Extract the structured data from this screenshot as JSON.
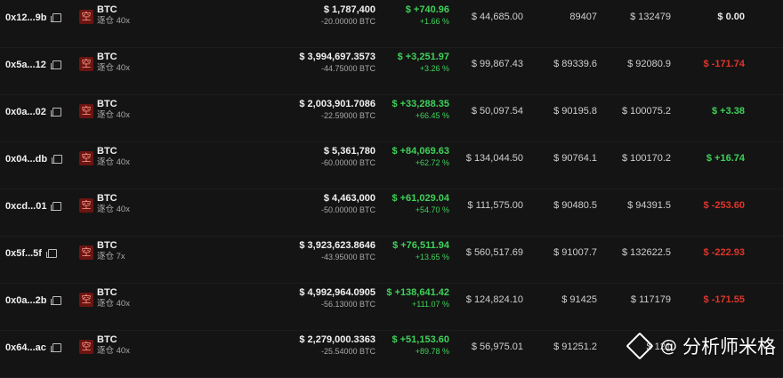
{
  "colors": {
    "positive": "#3fd15a",
    "negative": "#e0352b",
    "neutral": "#eaeaea",
    "badge_bg": "#6b1512"
  },
  "rows": [
    {
      "address": "0x12...9b",
      "badge": "空",
      "coin": "BTC",
      "leverage": "逐仓 40x",
      "size_usd": "$ 1,787,400",
      "size_qty": "-20.00000 BTC",
      "pnl_usd": "$ +740.96",
      "pnl_pct": "+1.66 %",
      "entry": "$ 44,685.00",
      "mark": "89407",
      "liq": "$ 132479",
      "funding": "$ 0.00",
      "funding_color": "#eaeaea"
    },
    {
      "address": "0x5a...12",
      "badge": "空",
      "coin": "BTC",
      "leverage": "逐仓 40x",
      "size_usd": "$ 3,994,697.3573",
      "size_qty": "-44.75000 BTC",
      "pnl_usd": "$ +3,251.97",
      "pnl_pct": "+3.26 %",
      "entry": "$ 99,867.43",
      "mark": "$ 89339.6",
      "liq": "$ 92080.9",
      "funding": "$ -171.74",
      "funding_color": "#e0352b"
    },
    {
      "address": "0x0a...02",
      "badge": "空",
      "coin": "BTC",
      "leverage": "逐仓 40x",
      "size_usd": "$ 2,003,901.7086",
      "size_qty": "-22.59000 BTC",
      "pnl_usd": "$ +33,288.35",
      "pnl_pct": "+66.45 %",
      "entry": "$ 50,097.54",
      "mark": "$ 90195.8",
      "liq": "$ 100075.2",
      "funding": "$ +3.38",
      "funding_color": "#3fd15a"
    },
    {
      "address": "0x04...db",
      "badge": "空",
      "coin": "BTC",
      "leverage": "逐仓 40x",
      "size_usd": "$ 5,361,780",
      "size_qty": "-60.00000 BTC",
      "pnl_usd": "$ +84,069.63",
      "pnl_pct": "+62.72 %",
      "entry": "$ 134,044.50",
      "mark": "$ 90764.1",
      "liq": "$ 100170.2",
      "funding": "$ +16.74",
      "funding_color": "#3fd15a"
    },
    {
      "address": "0xcd...01",
      "badge": "空",
      "coin": "BTC",
      "leverage": "逐仓 40x",
      "size_usd": "$ 4,463,000",
      "size_qty": "-50.00000 BTC",
      "pnl_usd": "$ +61,029.04",
      "pnl_pct": "+54.70 %",
      "entry": "$ 111,575.00",
      "mark": "$ 90480.5",
      "liq": "$ 94391.5",
      "funding": "$ -253.60",
      "funding_color": "#e0352b"
    },
    {
      "address": "0x5f...5f",
      "badge": "空",
      "coin": "BTC",
      "leverage": "逐仓 7x",
      "size_usd": "$ 3,923,623.8646",
      "size_qty": "-43.95000 BTC",
      "pnl_usd": "$ +76,511.94",
      "pnl_pct": "+13.65 %",
      "entry": "$ 560,517.69",
      "mark": "$ 91007.7",
      "liq": "$ 132622.5",
      "funding": "$ -222.93",
      "funding_color": "#e0352b"
    },
    {
      "address": "0x0a...2b",
      "badge": "空",
      "coin": "BTC",
      "leverage": "逐仓 40x",
      "size_usd": "$ 4,992,964.0905",
      "size_qty": "-56.13000 BTC",
      "pnl_usd": "$ +138,641.42",
      "pnl_pct": "+111.07 %",
      "entry": "$ 124,824.10",
      "mark": "$ 91425",
      "liq": "$ 117179",
      "funding": "$ -171.55",
      "funding_color": "#e0352b"
    },
    {
      "address": "0x64...ac",
      "badge": "空",
      "coin": "BTC",
      "leverage": "逐仓 40x",
      "size_usd": "$ 2,279,000.3363",
      "size_qty": "-25.54000 BTC",
      "pnl_usd": "$ +51,153.60",
      "pnl_pct": "+89.78 %",
      "entry": "$ 56,975.01",
      "mark": "$ 91251.2",
      "liq": "$ 121",
      "funding": "",
      "funding_color": "#eaeaea"
    }
  ],
  "watermark": {
    "at": "@",
    "text": "分析师米格"
  }
}
